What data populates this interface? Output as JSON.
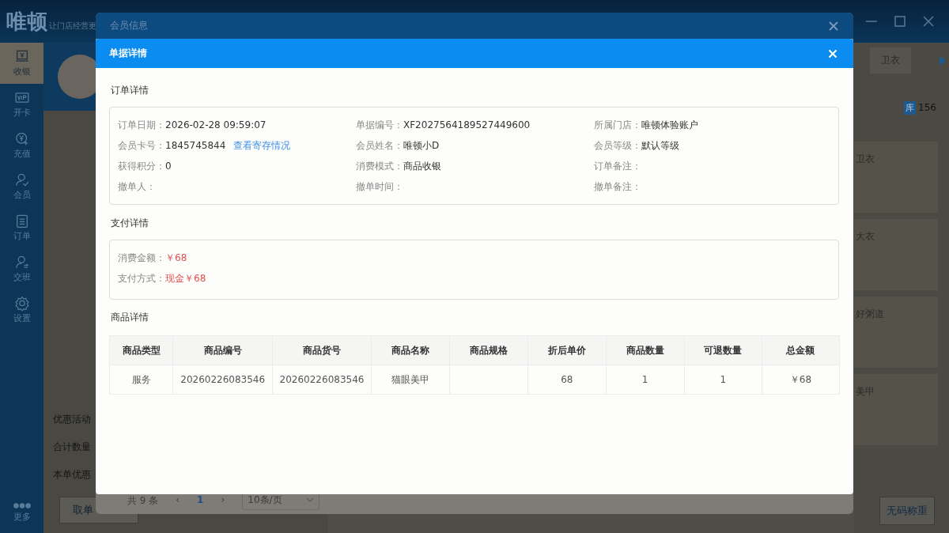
{
  "app": {
    "logo": "唯顿",
    "slogan": "让门店经营更",
    "sidebar": [
      {
        "label": "收银",
        "selected": true
      },
      {
        "label": "开卡",
        "selected": false
      },
      {
        "label": "充值",
        "selected": false
      },
      {
        "label": "会员",
        "selected": false
      },
      {
        "label": "订单",
        "selected": false
      },
      {
        "label": "交班",
        "selected": false
      },
      {
        "label": "设置",
        "selected": false
      },
      {
        "label": "更多",
        "selected": false
      }
    ]
  },
  "left_panel": {
    "rows": [
      "优惠活动",
      "合计数量",
      "本单优惠"
    ],
    "button": "取单"
  },
  "right_panel": {
    "tab": "卫衣",
    "stock_badge": "库",
    "stock": "156",
    "products": [
      "卫衣",
      "大衣",
      "好粥道",
      "美甲"
    ],
    "button": "无码称重"
  },
  "member_dialog": {
    "title": "会员信息",
    "pagination": {
      "total": "共 9 条",
      "prev": "‹",
      "page": "1",
      "next": "›",
      "page_size": "10条/页"
    }
  },
  "detail_dialog": {
    "title": "单据详情",
    "order": {
      "title": "订单详情",
      "fields": [
        {
          "label": "订单日期：",
          "value": "2026-02-28 09:59:07"
        },
        {
          "label": "单据编号：",
          "value": "XF2027564189527449600"
        },
        {
          "label": "所属门店：",
          "value": "唯顿体验账户"
        },
        {
          "label": "会员卡号：",
          "value": "1845745844",
          "link": "查看寄存情况"
        },
        {
          "label": "会员姓名：",
          "value": "唯顿小D"
        },
        {
          "label": "会员等级：",
          "value": "默认等级"
        },
        {
          "label": "获得积分：",
          "value": "0"
        },
        {
          "label": "消费模式：",
          "value": "商品收银"
        },
        {
          "label": "订单备注："
        },
        {
          "label": "撤单人："
        },
        {
          "label": "撤单时间："
        },
        {
          "label": "撤单备注："
        }
      ]
    },
    "payment": {
      "title": "支付详情",
      "fields": [
        {
          "label": "消费金额：",
          "value": "￥68"
        },
        {
          "label": "支付方式：",
          "value": "现金￥68"
        }
      ]
    },
    "goods": {
      "title": "商品详情",
      "columns": [
        "商品类型",
        "商品编号",
        "商品货号",
        "商品名称",
        "商品规格",
        "折后单价",
        "商品数量",
        "可退数量",
        "总金额"
      ],
      "rows": [
        [
          "服务",
          "20260226083546",
          "20260226083546",
          "猫眼美甲",
          "",
          "68",
          "1",
          "1",
          "￥68"
        ]
      ]
    }
  }
}
